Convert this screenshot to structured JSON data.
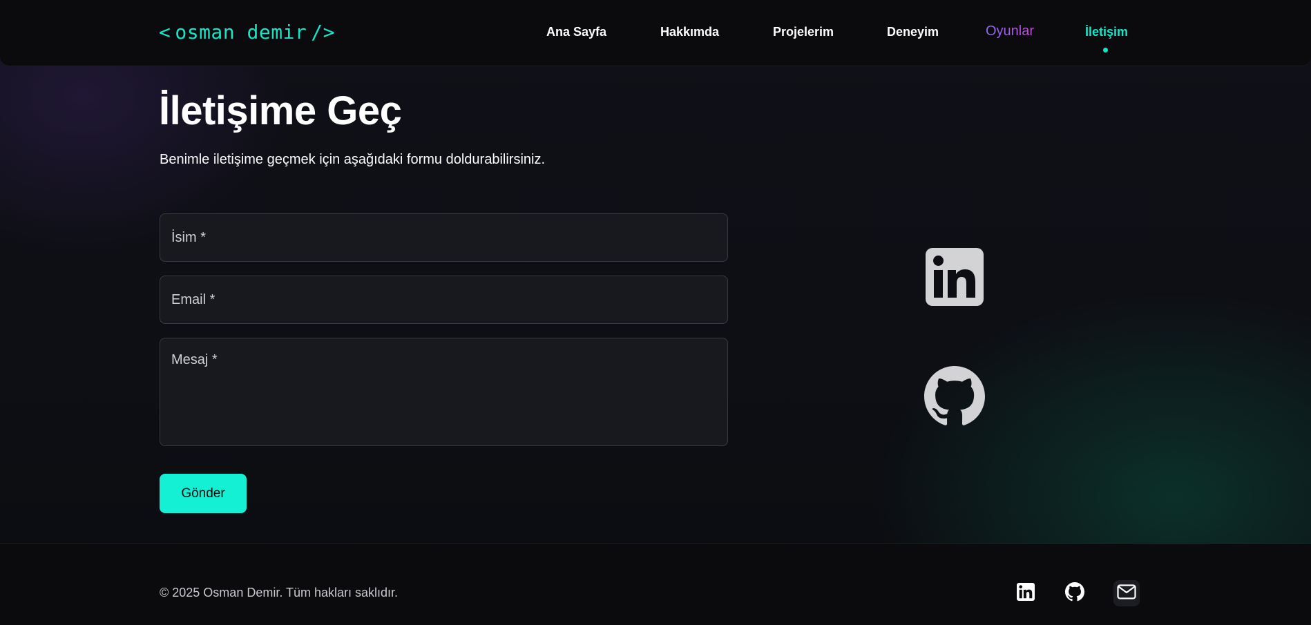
{
  "header": {
    "logo": {
      "open_bracket": "<",
      "name": "osman demir",
      "close_bracket": "/>"
    },
    "nav": [
      {
        "label": "Ana Sayfa"
      },
      {
        "label": "Hakkımda"
      },
      {
        "label": "Projelerim"
      },
      {
        "label": "Deneyim"
      },
      {
        "label": "Oyunlar"
      },
      {
        "label": "İletişim"
      }
    ],
    "active_nav": "İletişim"
  },
  "main": {
    "title": "İletişime Geç",
    "subtitle": "Benimle iletişime geçmek için aşağıdaki formu doldurabilirsiniz.",
    "form": {
      "name_placeholder": "İsim *",
      "email_placeholder": "Email *",
      "message_placeholder": "Mesaj *",
      "submit_label": "Gönder"
    },
    "social": [
      {
        "icon": "linkedin-icon"
      },
      {
        "icon": "github-icon"
      }
    ]
  },
  "footer": {
    "copyright": "© 2025 Osman Demir. Tüm hakları saklıdır.",
    "icons": [
      "linkedin-icon",
      "github-icon",
      "mail-icon"
    ]
  },
  "colors": {
    "accent": "#14e6c8",
    "button": "#14f0d4",
    "games_gradient_start": "#8a6cf0",
    "games_gradient_end": "#c04bd6",
    "background": "#0c0d12",
    "field_background": "#18191e"
  }
}
